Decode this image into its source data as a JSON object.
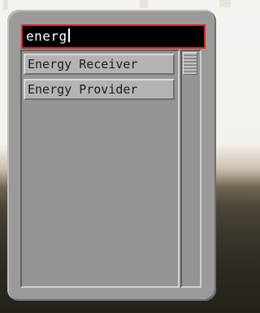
{
  "search": {
    "value": "energ"
  },
  "results": {
    "items": [
      {
        "label": "Energy Receiver"
      },
      {
        "label": "Energy Provider"
      }
    ]
  },
  "colors": {
    "panel": "#9a9a9a",
    "search_background": "#000000",
    "search_border": "#e02424",
    "item_background": "#b3b3b3"
  }
}
